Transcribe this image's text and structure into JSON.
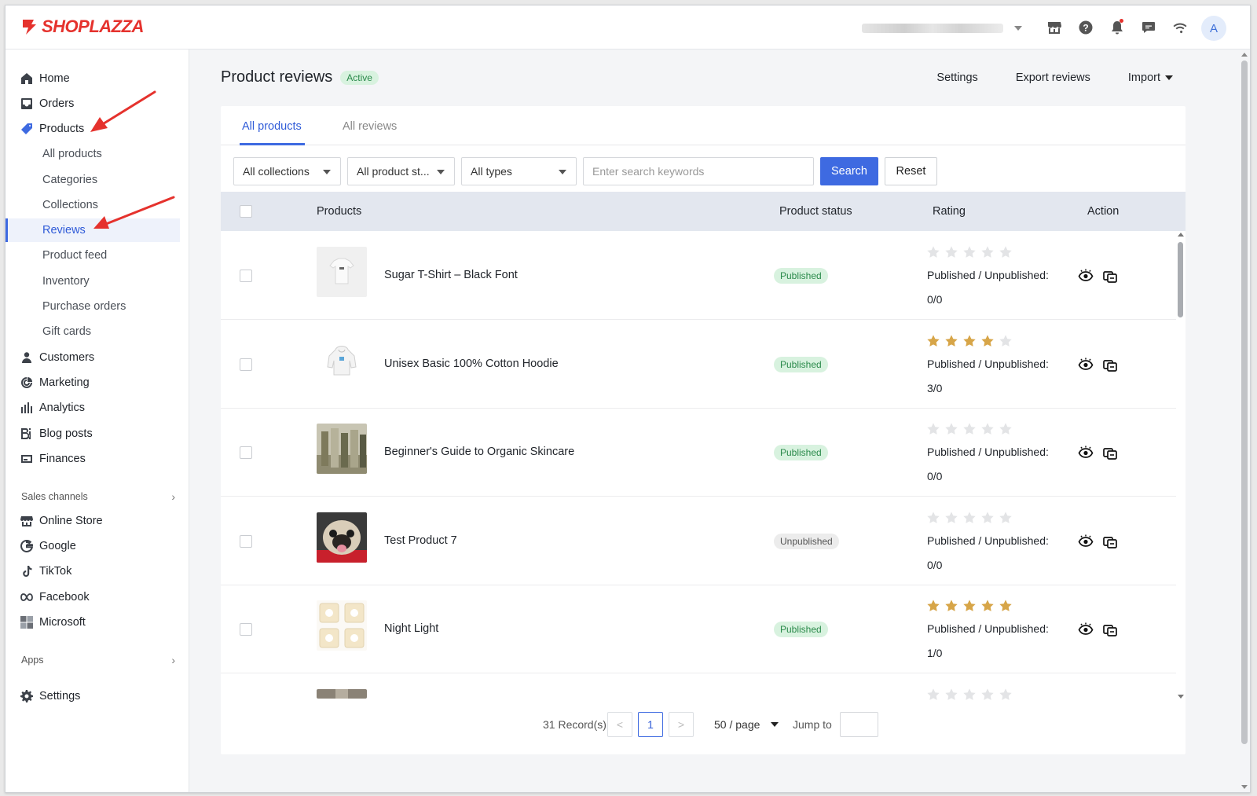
{
  "brand": {
    "name": "SHOPLAZZA",
    "color": "#e5322d"
  },
  "topbar": {
    "avatar_letter": "A",
    "icons": [
      "store-icon",
      "help-icon",
      "bell-icon",
      "chat-icon",
      "wifi-icon"
    ]
  },
  "sidebar": {
    "items": [
      {
        "label": "Home",
        "icon": "home-icon"
      },
      {
        "label": "Orders",
        "icon": "orders-icon"
      },
      {
        "label": "Products",
        "icon": "tag-icon"
      }
    ],
    "product_sub": [
      "All products",
      "Categories",
      "Collections",
      "Reviews",
      "Product feed",
      "Inventory",
      "Purchase orders",
      "Gift cards"
    ],
    "items2": [
      {
        "label": "Customers",
        "icon": "person-icon"
      },
      {
        "label": "Marketing",
        "icon": "marketing-icon"
      },
      {
        "label": "Analytics",
        "icon": "analytics-icon"
      },
      {
        "label": "Blog posts",
        "icon": "blog-icon"
      },
      {
        "label": "Finances",
        "icon": "finances-icon"
      }
    ],
    "sales_channels_label": "Sales channels",
    "channels": [
      {
        "label": "Online Store",
        "icon": "store-icon"
      },
      {
        "label": "Google",
        "icon": "google-icon"
      },
      {
        "label": "TikTok",
        "icon": "tiktok-icon"
      },
      {
        "label": "Facebook",
        "icon": "meta-icon"
      },
      {
        "label": "Microsoft",
        "icon": "microsoft-icon"
      }
    ],
    "apps_label": "Apps",
    "settings_label": "Settings"
  },
  "header": {
    "title": "Product reviews",
    "status_badge": "Active",
    "settings": "Settings",
    "export": "Export reviews",
    "import": "Import"
  },
  "tabs": [
    "All products",
    "All reviews"
  ],
  "filters": {
    "collections": "All collections",
    "product_status": "All product st...",
    "types": "All types",
    "search_placeholder": "Enter search keywords",
    "search_button": "Search",
    "reset_button": "Reset"
  },
  "table": {
    "columns": [
      "Products",
      "Product status",
      "Rating",
      "Action"
    ],
    "rating_label": "Published / Unpublished:",
    "rows": [
      {
        "name": "Sugar T-Shirt – Black Font",
        "status": "Published",
        "stars": 0,
        "counts": "0/0",
        "thumb": "tshirt"
      },
      {
        "name": "Unisex Basic 100% Cotton Hoodie",
        "status": "Published",
        "stars": 4,
        "counts": "3/0",
        "thumb": "hoodie"
      },
      {
        "name": "Beginner's Guide to Organic Skincare",
        "status": "Published",
        "stars": 0,
        "counts": "0/0",
        "thumb": "people"
      },
      {
        "name": "Test Product 7",
        "status": "Unpublished",
        "stars": 0,
        "counts": "0/0",
        "thumb": "pug"
      },
      {
        "name": "Night Light",
        "status": "Published",
        "stars": 5,
        "counts": "1/0",
        "thumb": "lights"
      },
      {
        "name": "",
        "status": "",
        "stars": 0,
        "counts": "",
        "thumb": "partial"
      }
    ]
  },
  "pagination": {
    "records": "31 Record(s)",
    "prev": "<",
    "current": "1",
    "next": ">",
    "per_page": "50 / page",
    "jump_to": "Jump to"
  },
  "colors": {
    "accent": "#3e6ae1",
    "star_filled": "#d7a548",
    "star_empty": "#e3e4e6",
    "published_bg": "#d8f2df",
    "unpublished_bg": "#ececec"
  }
}
